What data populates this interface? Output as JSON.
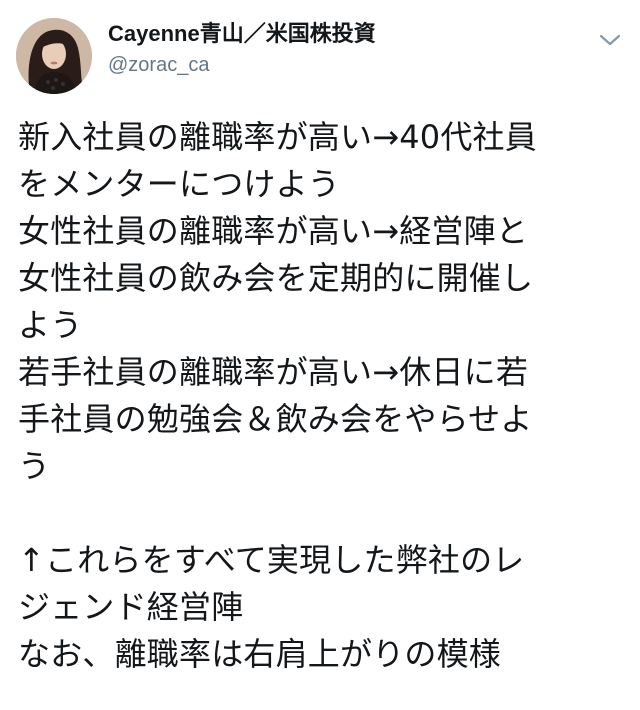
{
  "tweet": {
    "author": {
      "display_name": "Cayenne青山／米国株投資",
      "handle": "@zorac_ca",
      "avatar": "user-avatar-photo"
    },
    "menu_icon": "chevron-down-icon",
    "text_lines": [
      "新入社員の離職率が高い→40代社員",
      "をメンターにつけよう",
      "女性社員の離職率が高い→経営陣と",
      "女性社員の飲み会を定期的に開催し",
      "よう",
      "若手社員の離職率が高い→休日に若",
      "手社員の勉強会＆飲み会をやらせよ",
      "う",
      "",
      "↑これらをすべて実現した弊社のレ",
      "ジェンド経営陣",
      "なお、離職率は右肩上がりの模様"
    ]
  },
  "colors": {
    "text": "#14171a",
    "secondary_text": "#657786",
    "background": "#ffffff"
  }
}
